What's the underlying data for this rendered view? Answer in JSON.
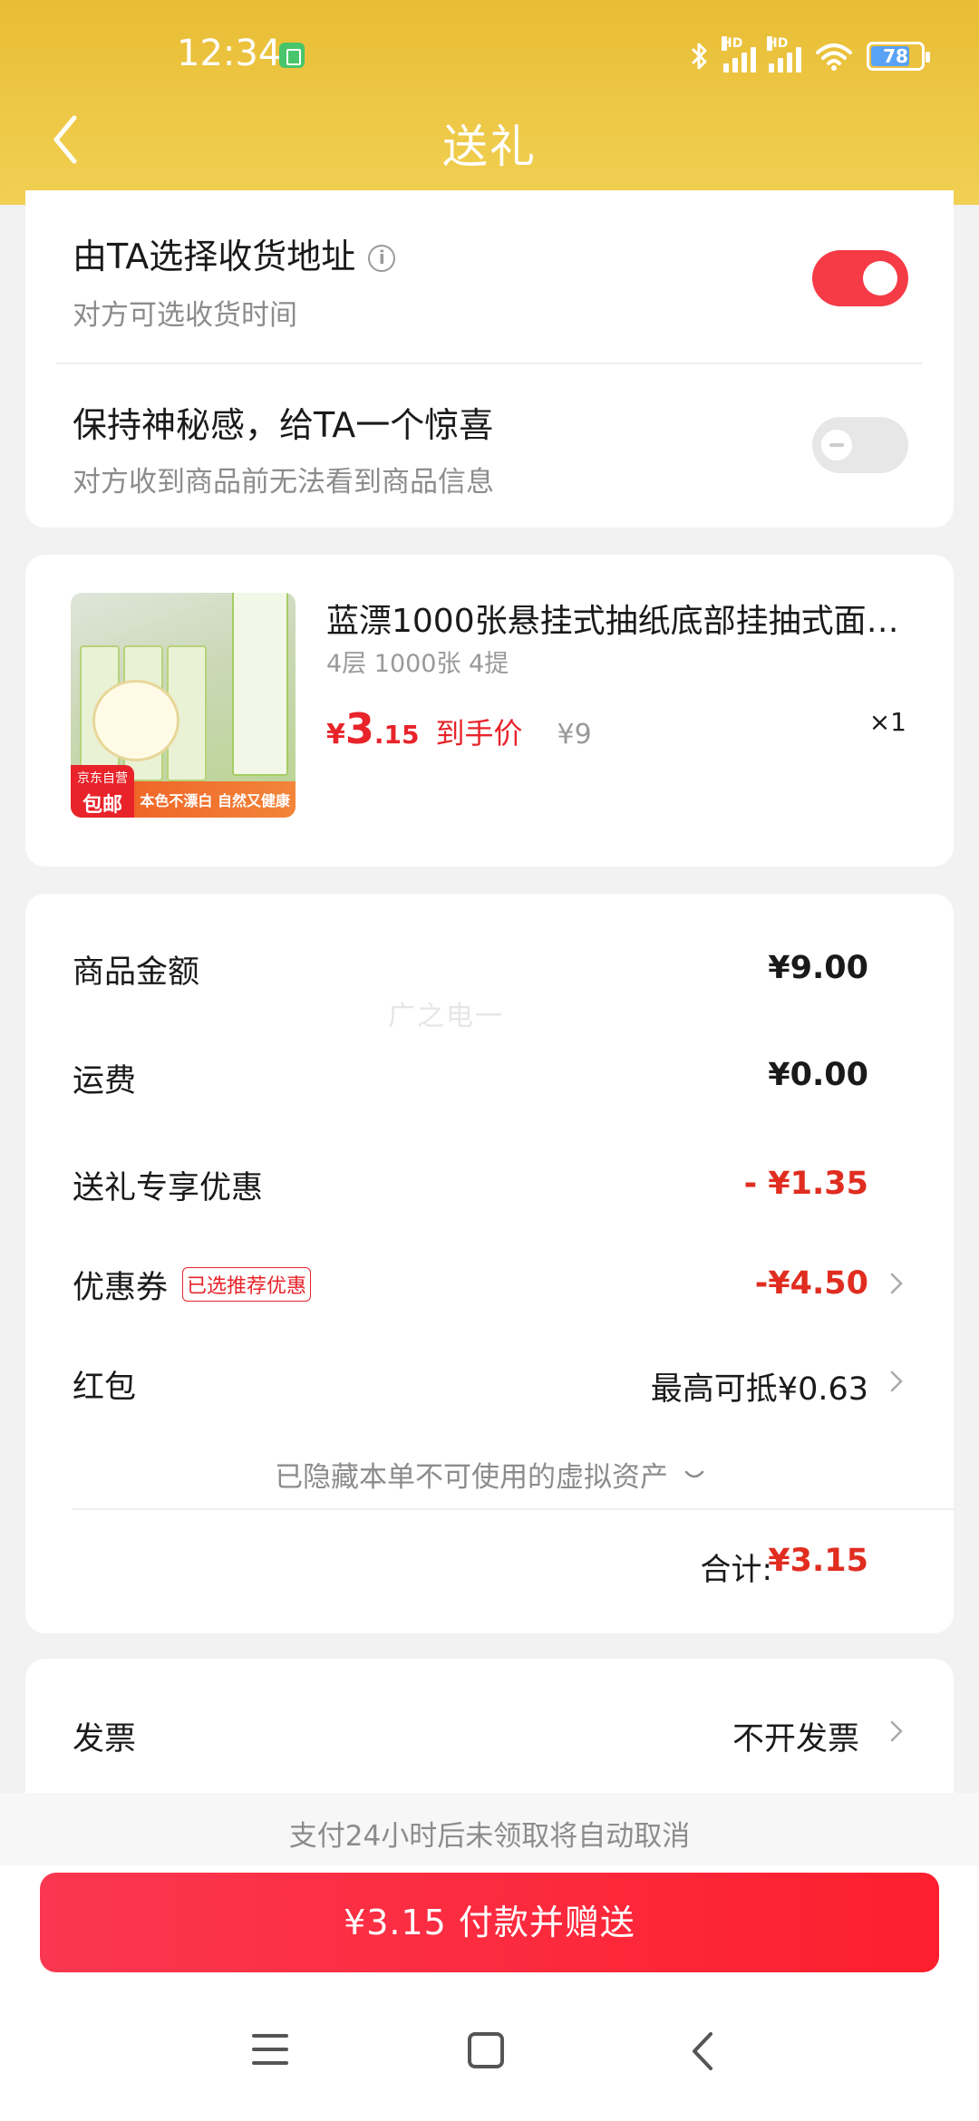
{
  "status_bar": {
    "time": "12:34",
    "battery_level": "78",
    "signal_label": "HD"
  },
  "nav": {
    "title": "送礼"
  },
  "options": [
    {
      "title": "由TA选择收货地址",
      "subtitle": "对方可选收货时间",
      "enabled": true
    },
    {
      "title": "保持神秘感，给TA一个惊喜",
      "subtitle": "对方收到商品前无法看到商品信息",
      "enabled": false
    }
  ],
  "product": {
    "title": "蓝漂1000张悬挂式抽纸底部挂抽式面…",
    "spec": "4层 1000张 4提",
    "price_currency": "¥",
    "price_int": "3",
    "price_dec": ".15",
    "price_label": "到手价",
    "original_price": "¥9",
    "quantity": "×1",
    "image_badge_top": "京东自营",
    "image_badge_bottom": "包邮",
    "image_strip": "本色不漂白 自然又健康"
  },
  "cost": {
    "watermark": "广之电一",
    "rows": [
      {
        "label": "商品金额",
        "value": "¥9.00"
      },
      {
        "label": "运费",
        "value": "¥0.00"
      },
      {
        "label": "送礼专享优惠",
        "value": "- ¥1.35"
      },
      {
        "label": "优惠券",
        "tag": "已选推荐优惠",
        "value": "-¥4.50"
      },
      {
        "label": "红包",
        "value": "最高可抵¥0.63"
      }
    ],
    "hidden_assets": "已隐藏本单不可使用的虚拟资产",
    "total_label": "合计:",
    "total_value": "¥3.15"
  },
  "invoice": {
    "label": "发票",
    "value": "不开发票"
  },
  "footer": {
    "notice": "支付24小时后未领取将自动取消",
    "pay_button": "¥3.15 付款并赠送"
  },
  "colors": {
    "header": "#ebc23d",
    "accent_red": "#e8232a",
    "toggle_on": "#f43b46"
  }
}
